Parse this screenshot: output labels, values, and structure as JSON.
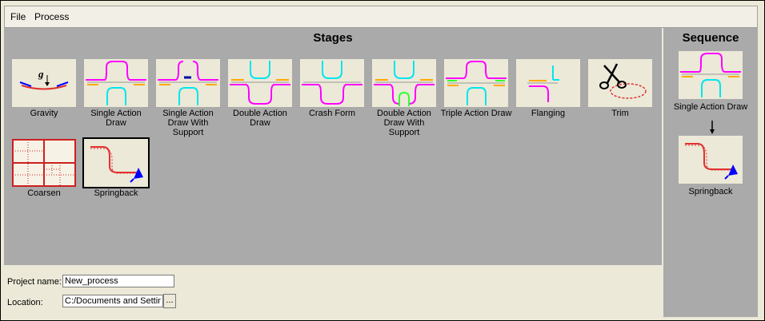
{
  "menu": {
    "file": "File",
    "process": "Process"
  },
  "stages": {
    "title": "Stages",
    "items": [
      {
        "label": "Gravity",
        "icon": "gravity-icon"
      },
      {
        "label": "Single Action Draw",
        "icon": "single-action-draw-icon"
      },
      {
        "label": "Single Action Draw With Support",
        "icon": "single-action-draw-support-icon"
      },
      {
        "label": "Double Action Draw",
        "icon": "double-action-draw-icon"
      },
      {
        "label": "Crash Form",
        "icon": "crash-form-icon"
      },
      {
        "label": "Double Action Draw With Support",
        "icon": "double-action-draw-support-icon"
      },
      {
        "label": "Triple Action Draw",
        "icon": "triple-action-draw-icon"
      },
      {
        "label": "Flanging",
        "icon": "flanging-icon"
      },
      {
        "label": "Trim",
        "icon": "scissors-icon"
      },
      {
        "label": "Coarsen",
        "icon": "coarsen-grid-icon"
      },
      {
        "label": "Springback",
        "icon": "springback-icon"
      }
    ]
  },
  "sequence": {
    "title": "Sequence",
    "items": [
      {
        "label": "Single Action Draw",
        "icon": "single-action-draw-icon"
      },
      {
        "label": "Springback",
        "icon": "springback-icon"
      }
    ]
  },
  "project": {
    "name_label": "Project name:",
    "name_value": "New_process",
    "location_label": "Location:",
    "location_value": "C:/Documents and Settin",
    "browse_label": "..."
  },
  "colors": {
    "magenta": "#ff00ff",
    "cyan": "#00e5ee",
    "orange": "#ffaa00",
    "green": "#33ff33",
    "red": "#e03030",
    "blue": "#0000ff",
    "panel": "#aaaaaa"
  }
}
